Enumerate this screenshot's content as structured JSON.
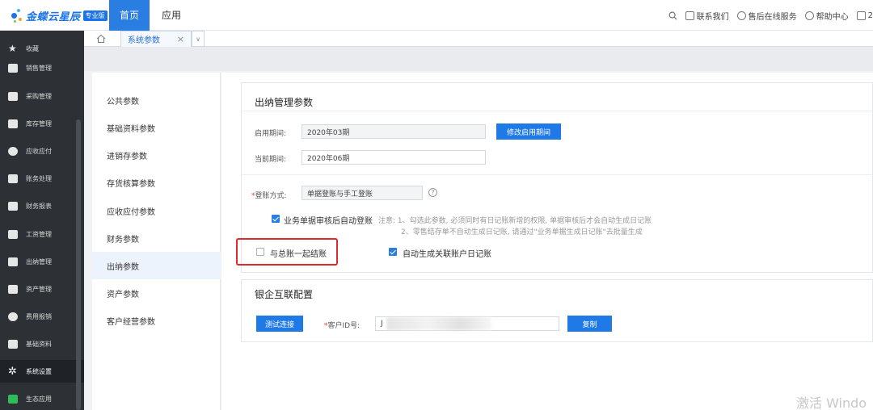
{
  "header": {
    "brand": "金蝶云星辰",
    "edition": "专业版",
    "nav": [
      "首页",
      "应用"
    ],
    "links": [
      "联系我们",
      "售后在线服务",
      "帮助中心",
      "2"
    ]
  },
  "sidebar": {
    "items": [
      "收藏",
      "销售管理",
      "采购管理",
      "库存管理",
      "应收应付",
      "账务处理",
      "财务报表",
      "工资管理",
      "出纳管理",
      "资产管理",
      "费用报销",
      "基础资料",
      "系统设置",
      "生态应用"
    ]
  },
  "tabs": {
    "current": "系统参数",
    "close": "×",
    "more": "∨"
  },
  "param_menu": {
    "items": [
      "公共参数",
      "基础资料参数",
      "进销存参数",
      "存货核算参数",
      "应收应付参数",
      "财务参数",
      "出纳参数",
      "资产参数",
      "客户经营参数"
    ],
    "active": "出纳参数"
  },
  "cashier": {
    "title": "出纳管理参数",
    "start_label": "启用期间:",
    "start_value": "2020年03期",
    "modify_button": "修改启用期间",
    "current_label": "当前期间:",
    "current_value": "2020年06期",
    "method_label": "登账方式:",
    "method_value": "单据登账与手工登账",
    "help": "?",
    "auto_post_label": "业务单据审核后自动登账",
    "note1": "注意: 1、勾选此参数, 必须同时有日记账新增的权限, 单据审核后才会自动生成日记账",
    "note2": "2、零售结存单不自动生成日记账, 请通过\"业务单据生成日记账\"去批量生成",
    "close_with_gl_label": "与总账一起结账",
    "auto_journal_label": "自动生成关联账户日记账"
  },
  "bank": {
    "title": "银企互联配置",
    "test_button": "测试连接",
    "client_id_label": "客户ID号:",
    "client_id_value": "J",
    "copy_button": "复制"
  },
  "watermark": "激活 Windo",
  "colors": {
    "primary": "#2a7de1",
    "sidebar": "#2d3035",
    "highlight": "#e02a2a"
  }
}
